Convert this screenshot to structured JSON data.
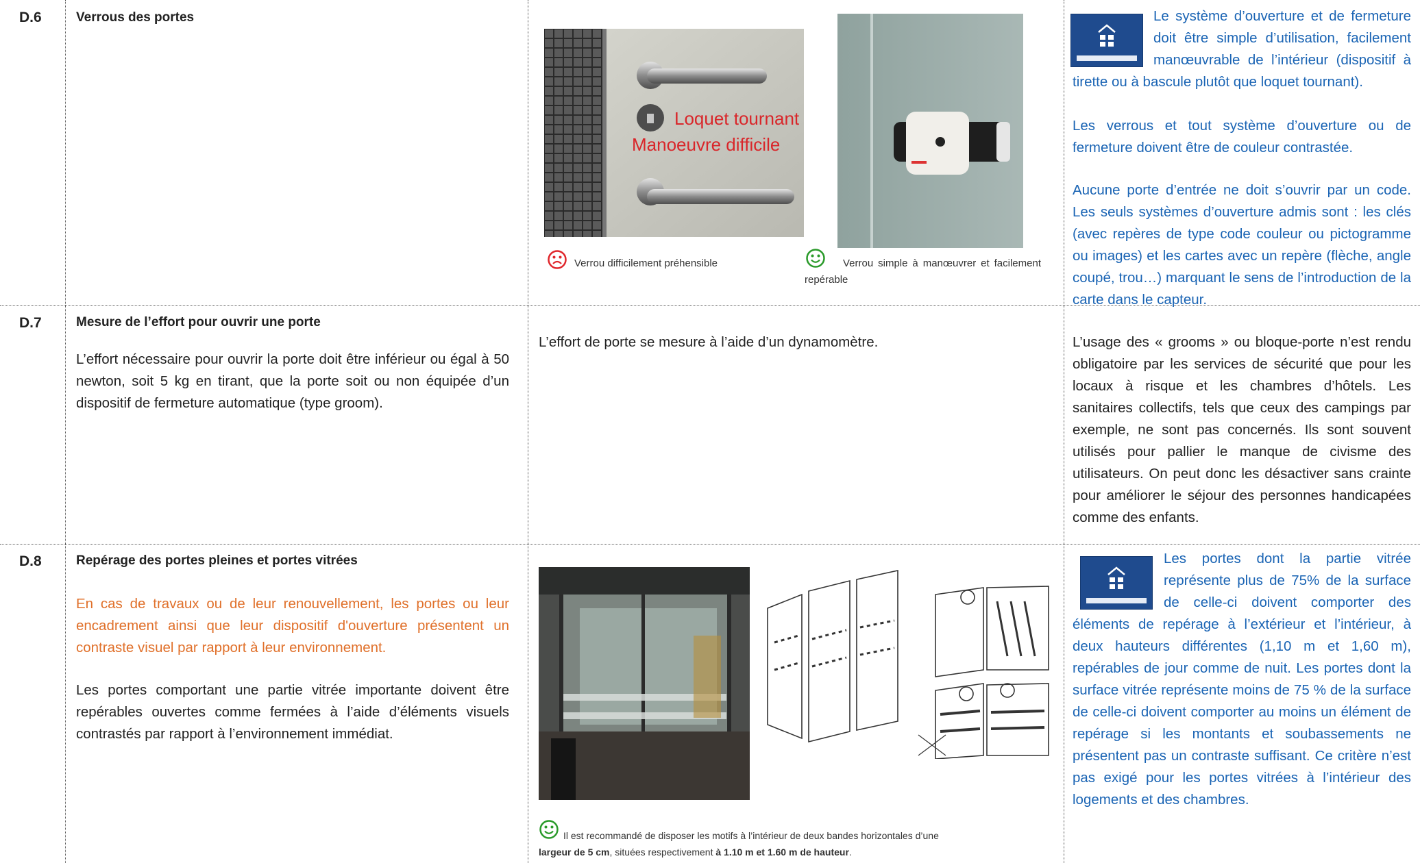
{
  "rows": [
    {
      "code": "D.6",
      "title": "Verrous des portes",
      "captions": {
        "bad": "Verrou difficilement préhensible",
        "good": "Verrou simple à manœuvrer et facilement repérable"
      },
      "photo_text": {
        "line1": "Loquet tournant",
        "line2": "Manoeuvre difficile"
      },
      "note_intro": "Le système d’ouverture et de fermeture doit être simple d’utilisation, facilement manœuvrable de l’intérieur (dispositif à tirette ou à bascule plutôt que loquet tournant).",
      "note_colour": "Les verrous et tout système d’ouverture ou de fermeture doivent être de couleur contrastée.",
      "note_code": "Aucune porte d’entrée ne doit s’ouvrir par un code. Les seuls systèmes d’ouverture admis sont : les clés (avec repères de type code couleur ou pictogramme ou images) et les cartes avec un repère (flèche, angle coupé, trou…) marquant le sens de l’introduction de la carte dans le capteur."
    },
    {
      "code": "D.7",
      "title": "Mesure de l’effort pour ouvrir une porte",
      "body": "L’effort nécessaire pour ouvrir la porte doit être inférieur ou égal à 50 newton, soit 5 kg en tirant, que la porte soit ou non équipée d’un dispositif de fermeture automatique (type groom).",
      "middle": "L’effort de porte se mesure à l’aide d’un dynamomètre.",
      "note": "L’usage des « grooms » ou bloque-porte n’est rendu obligatoire par les services de sécurité que pour les locaux à risque et les chambres d’hôtels. Les sanitaires collectifs, tels que ceux des campings par exemple, ne sont pas concernés. Ils sont souvent utilisés pour pallier le manque de civisme des utilisateurs. On peut donc les désactiver sans crainte pour améliorer le séjour des personnes handicapées comme des enfants."
    },
    {
      "code": "D.8",
      "title": "Repérage des portes pleines et portes vitrées",
      "body_orange": "En cas de travaux ou de leur renouvellement, les portes ou leur encadrement ainsi que leur dispositif d'ouverture présentent un contraste visuel par rapport à leur environnement.",
      "body": "Les portes comportant une partie vitrée importante doivent être repérables ouvertes comme fermées à l’aide d’éléments visuels contrastés par rapport à l’environnement immédiat.",
      "caption_a": "Il est recommandé de disposer les motifs à l’intérieur de deux bandes horizontales d’une",
      "caption_b1": "largeur de 5 cm",
      "caption_b2": ", situées respectivement ",
      "caption_b3": "à 1.10 m et 1.60 m de hauteur",
      "caption_b4": ".",
      "note": "Les portes dont la partie vitrée représente plus de 75% de la surface de celle-ci doivent comporter des éléments de repérage à l’extérieur et l’intérieur, à deux hauteurs différentes (1,10 m et 1,60 m), repérables de jour comme de nuit. Les portes dont la surface vitrée représente moins de 75 % de la surface de celle-ci doivent comporter au moins un élément de repérage si les montants et soubassements ne présentent pas un contraste suffisant. Ce critère n’est pas exigé pour les portes vitrées à l’intérieur des logements et des chambres."
    }
  ],
  "colors": {
    "blue": "#1a64b4",
    "orange": "#e0702a",
    "sad": "#e0262b",
    "happy": "#2a9a2a"
  }
}
